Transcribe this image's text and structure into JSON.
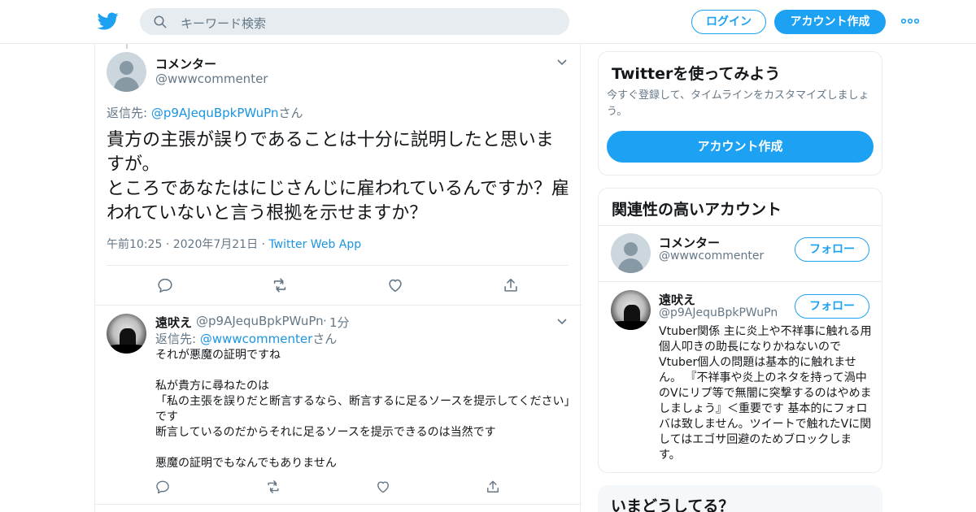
{
  "header": {
    "search_placeholder": "キーワード検索",
    "login_label": "ログイン",
    "signup_label": "アカウント作成",
    "brand_color": "#1da1f2"
  },
  "main_tweet": {
    "name": "コメンター",
    "handle": "@wwwcommenter",
    "reply_prefix": "返信先: ",
    "reply_mention": "@p9AJequBpkPWuPn",
    "reply_suffix": "さん",
    "text_lines": [
      "貴方の主張が誤りであることは十分に説明したと思いますが。",
      "ところであなたはにじさんじに雇われているんですか？雇われていないと言う根拠を示せますか？"
    ],
    "time": "午前10:25",
    "date": "2020年7月21日",
    "app": "Twitter Web App",
    "separator": "·"
  },
  "reply_tweet": {
    "name": "遠吠え",
    "handle": "@p9AJequBpkPWuPn",
    "time_ago": "1分",
    "reply_prefix": "返信先: ",
    "reply_mention": "@wwwcommenter",
    "reply_suffix": "さん",
    "lines": [
      "それが悪魔の証明ですね",
      "",
      "私が貴方に尋ねたのは",
      "「私の主張を誤りだと断言するなら、断言するに足るソースを提示してください」です",
      "断言しているのだからそれに足るソースを提示できるのは当然です",
      "",
      "悪魔の証明でもなんでもありません"
    ]
  },
  "sidebar": {
    "signup_card": {
      "title": "Twitterを使ってみよう",
      "subtitle": "今すぐ登録して、タイムラインをカスタマイズしましょう。",
      "button": "アカウント作成"
    },
    "related_card": {
      "title": "関連性の高いアカウント",
      "accounts": [
        {
          "name": "コメンター",
          "handle": "@wwwcommenter",
          "follow": "フォロー"
        },
        {
          "name": "遠吠え",
          "handle": "@p9AJequBpkPWuPn",
          "follow": "フォロー",
          "bio": "Vtuber関係 主に炎上や不祥事に触れる用 個人叩きの助長になりかねないのでVtuber個人の問題は基本的に触れません。 『不祥事や炎上のネタを持って渦中のVにリプ等で無闇に突撃するのはやめましましょう』＜重要です 基本的にフォロバは致しません。ツイートで触れたVに関してはエゴサ回避のためブロックします。"
        }
      ]
    },
    "trends_card": {
      "title": "いまどうしてる？"
    }
  }
}
